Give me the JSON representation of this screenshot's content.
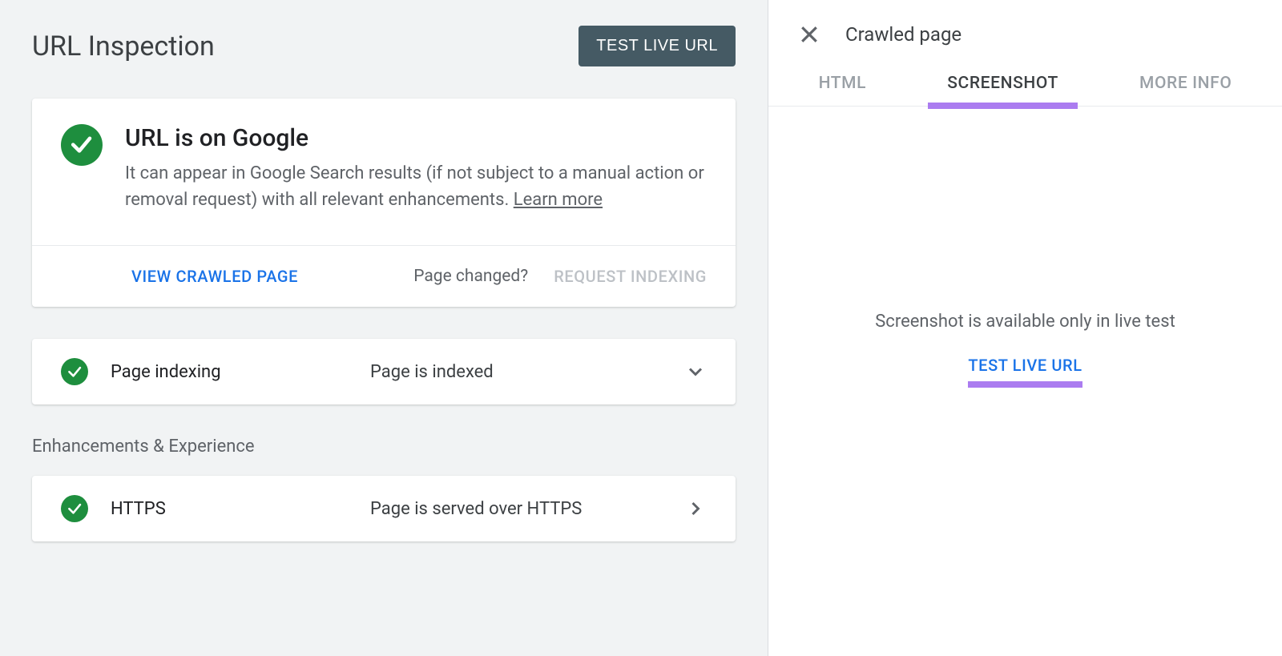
{
  "header": {
    "title": "URL Inspection",
    "test_live_label": "TEST LIVE URL"
  },
  "status_card": {
    "title": "URL is on Google",
    "description": "It can appear in Google Search results (if not subject to a manual action or removal request) with all relevant enhancements. ",
    "learn_more": "Learn more",
    "view_crawled_label": "VIEW CRAWLED PAGE",
    "page_changed_label": "Page changed?",
    "request_indexing_label": "REQUEST INDEXING"
  },
  "indexing_row": {
    "label": "Page indexing",
    "value": "Page is indexed"
  },
  "enhancements_heading": "Enhancements & Experience",
  "https_row": {
    "label": "HTTPS",
    "value": "Page is served over HTTPS"
  },
  "side_panel": {
    "title": "Crawled page",
    "tabs": {
      "html": "HTML",
      "screenshot": "SCREENSHOT",
      "more_info": "MORE INFO"
    },
    "empty_text": "Screenshot is available only in live test",
    "test_live_label": "TEST LIVE URL"
  }
}
